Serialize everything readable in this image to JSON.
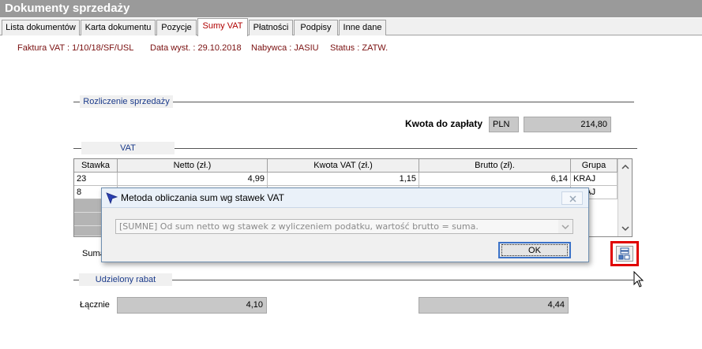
{
  "window": {
    "title": "Dokumenty sprzedaży"
  },
  "tabs": [
    {
      "label": "Lista dokumentów"
    },
    {
      "label": "Karta dokumentu"
    },
    {
      "label": "Pozycje"
    },
    {
      "label": "Sumy VAT",
      "active": true
    },
    {
      "label": "Płatności"
    },
    {
      "label": "Podpisy"
    },
    {
      "label": "Inne dane"
    }
  ],
  "header": {
    "invoice": "Faktura VAT : 1/10/18/SF/USL",
    "date": "Data wyst. : 29.10.2018",
    "buyer": "Nabywca : JASIU",
    "status": "Status : ZATW."
  },
  "settlement": {
    "group_title": "Rozliczenie sprzedaży",
    "total_label": "Kwota do zapłaty",
    "currency": "PLN",
    "total_value": "214,80"
  },
  "vat": {
    "group_title": "VAT",
    "columns": [
      "Stawka",
      "Netto (zł.)",
      "Kwota VAT (zł.)",
      "Brutto (zł).",
      "Grupa"
    ],
    "rows": [
      {
        "stawka": "23",
        "netto": "4,99",
        "vat": "1,15",
        "brutto": "6,14",
        "grupa": "KRAJ"
      },
      {
        "stawka": "8",
        "netto": "",
        "vat": "",
        "brutto": "",
        "grupa": "KRAJ"
      }
    ],
    "sum_label": "Suma"
  },
  "discount": {
    "group_title": "Udzielony rabat",
    "total_label": "Łącznie",
    "netto_value": "4,10",
    "brutto_value": "4,44"
  },
  "dialog": {
    "title": "Metoda obliczania sum wg stawek VAT",
    "selected_option": "[SUMNE] Od sum netto wg stawek z wyliczeniem podatku, wartość brutto = suma.",
    "ok_label": "OK"
  },
  "colors": {
    "highlight_frame": "#e00000",
    "active_tab_text": "#b00000",
    "info_text": "#7a1010",
    "group_title_text": "#1a3a8a"
  }
}
